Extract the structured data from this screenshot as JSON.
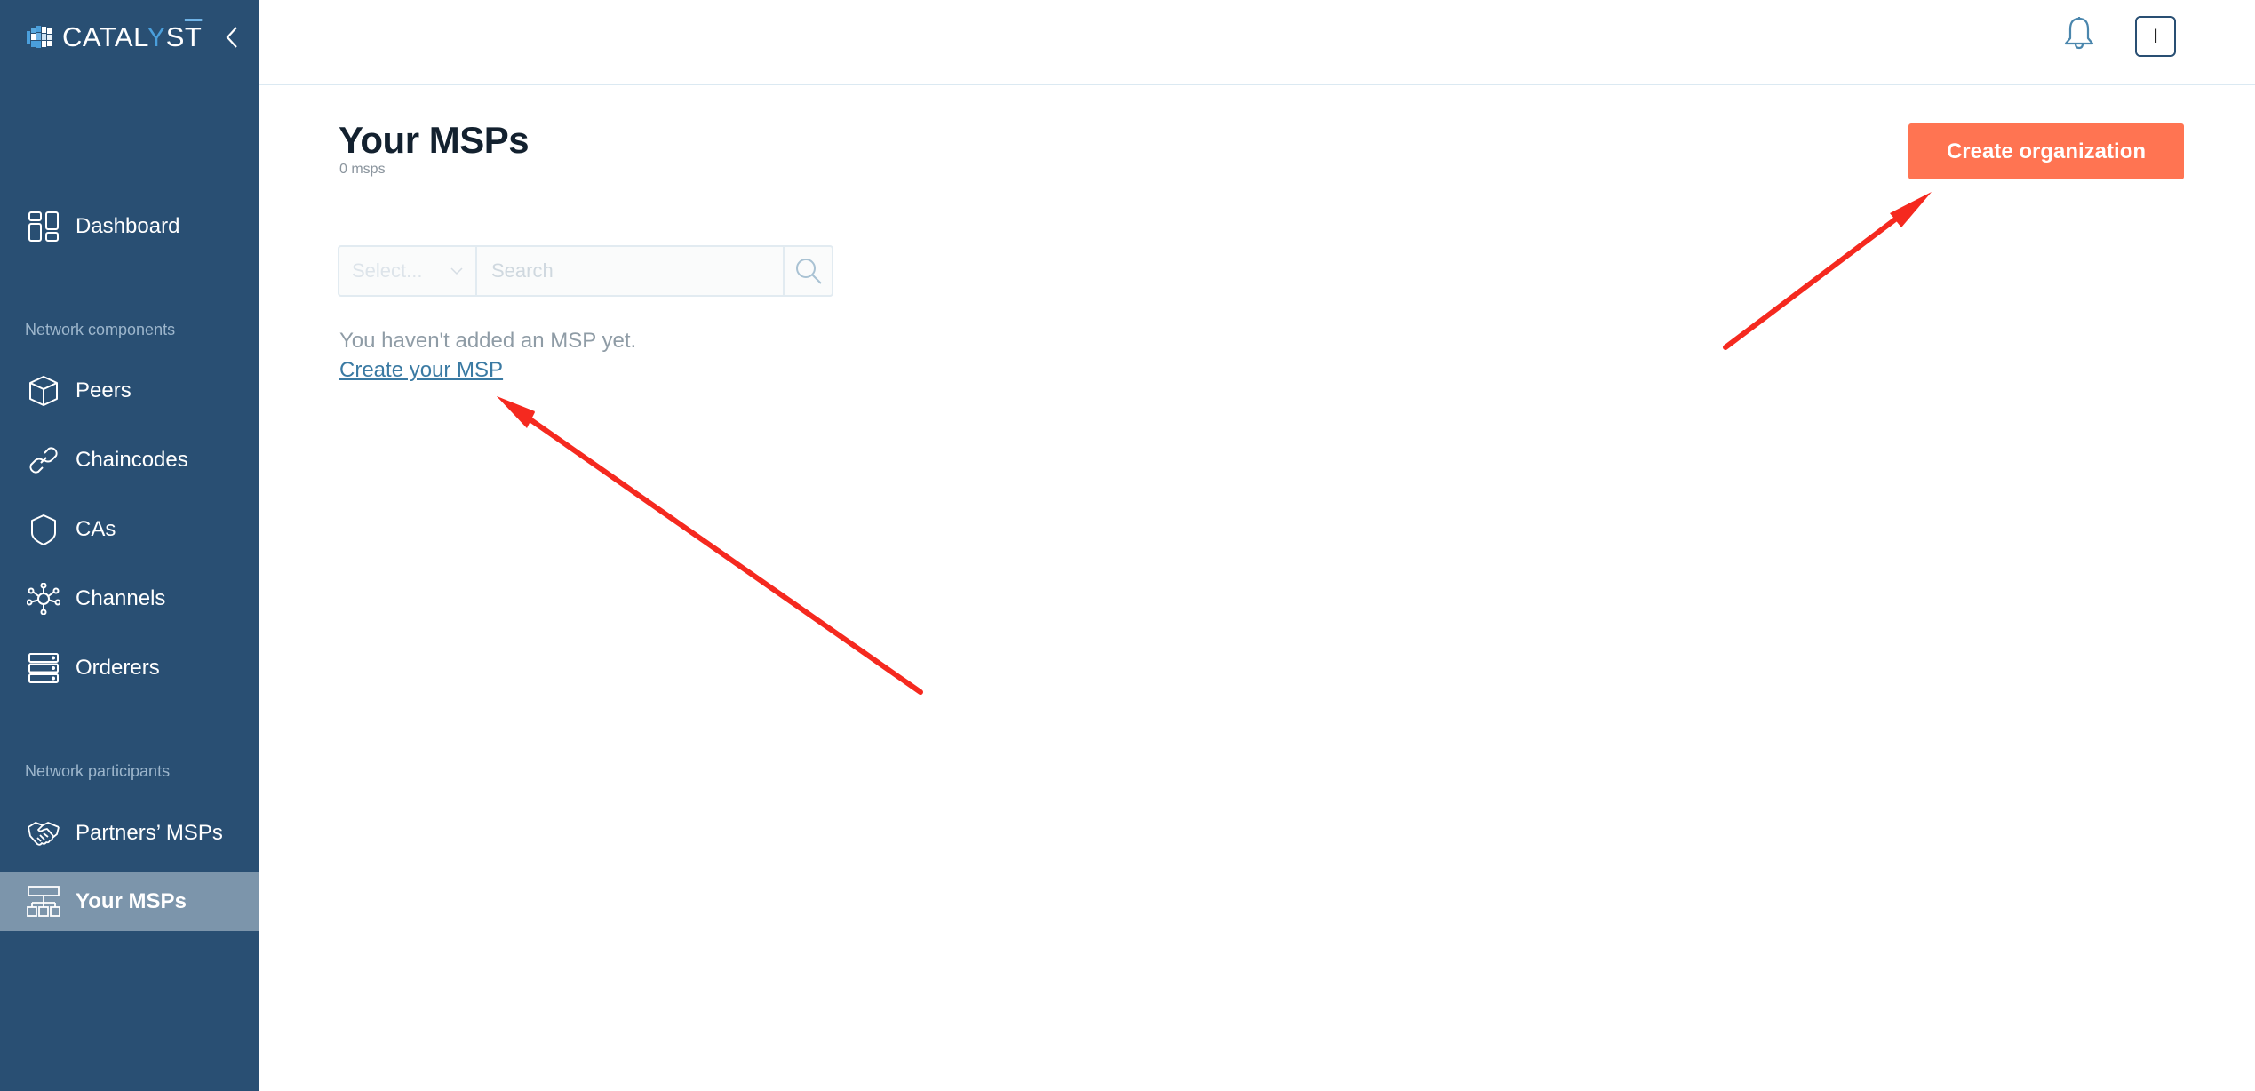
{
  "app": {
    "brand": {
      "prefix": "CATAL",
      "y": "Y",
      "s": "S",
      "t": "T"
    },
    "collapse_icon": "chevron-left-icon"
  },
  "sidebar": {
    "items": [
      {
        "label": "Dashboard",
        "icon": "dashboard-icon",
        "active": false
      },
      {
        "label": "Peers",
        "icon": "cube-icon",
        "active": false
      },
      {
        "label": "Chaincodes",
        "icon": "link-icon",
        "active": false
      },
      {
        "label": "CAs",
        "icon": "shield-icon",
        "active": false
      },
      {
        "label": "Channels",
        "icon": "network-icon",
        "active": false
      },
      {
        "label": "Orderers",
        "icon": "server-stack-icon",
        "active": false
      },
      {
        "label": "Partners’ MSPs",
        "icon": "handshake-icon",
        "active": false
      },
      {
        "label": "Your MSPs",
        "icon": "hierarchy-icon",
        "active": true
      }
    ],
    "sections": {
      "components": "Network components",
      "participants": "Network participants"
    }
  },
  "header": {
    "notifications_icon": "bell-icon",
    "avatar_initial": "I"
  },
  "main": {
    "title": "Your MSPs",
    "count": "0 msps",
    "create_button": "Create organization",
    "filter": {
      "select_placeholder": "Select...",
      "search_placeholder": "Search",
      "search_value": ""
    },
    "empty_state": {
      "message": "You haven't added an MSP yet.",
      "link": "Create your MSP"
    }
  },
  "annotations": {
    "color": "#f5291f",
    "arrows": [
      {
        "target": "create-your-msp-link"
      },
      {
        "target": "create-organization-button"
      }
    ]
  },
  "colors": {
    "sidebar": "#294f73",
    "sidebar_active": "#7c95ab",
    "primary_button": "#ff7452",
    "link": "#3a7aa3"
  }
}
